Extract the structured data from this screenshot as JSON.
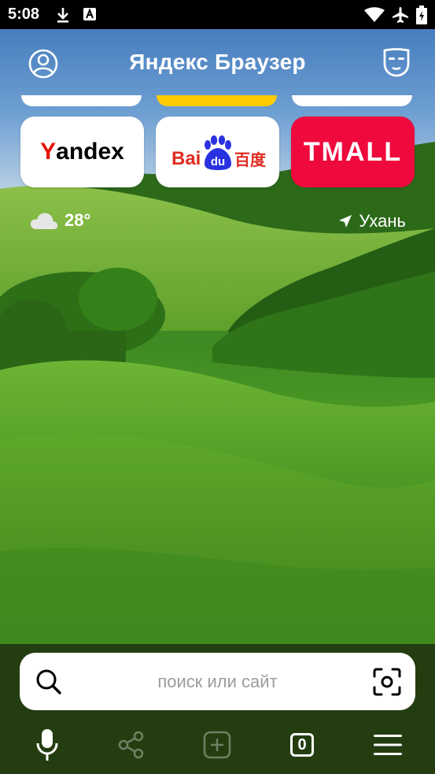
{
  "status_bar": {
    "time": "5:08",
    "icons": [
      "download-icon",
      "font-notification-icon",
      "wifi-icon",
      "airplane-mode-icon",
      "battery-icon"
    ]
  },
  "header": {
    "title": "Яндекс Браузер",
    "left_icon": "profile-icon",
    "right_icon": "incognito-mask-icon"
  },
  "tiles": {
    "partial_row": [
      "partial-tile-left",
      "partial-tile-yellow",
      "partial-tile-right"
    ],
    "row": [
      {
        "label_first": "Y",
        "label_rest": "andex",
        "color": "#e61400"
      },
      {
        "label": "Bai du 百度",
        "color": "#e02b20"
      },
      {
        "label": "TMALL",
        "color": "#ee0a3d"
      }
    ]
  },
  "weather": {
    "temperature": "28°",
    "icon": "cloud-icon"
  },
  "location": {
    "name": "Ухань",
    "icon": "location-arrow-icon"
  },
  "search": {
    "placeholder": "поиск или сайт"
  },
  "toolbar": {
    "tabs_count": "0",
    "buttons": [
      "microphone-icon",
      "share-icon",
      "new-tab-icon",
      "tabs-icon",
      "menu-icon"
    ]
  },
  "colors": {
    "bottom_panel": "#233d10",
    "tmall": "#ee0a3d",
    "baidu_red": "#e02b20",
    "baidu_blue": "#2932e1",
    "yandex_red": "#e61400"
  }
}
